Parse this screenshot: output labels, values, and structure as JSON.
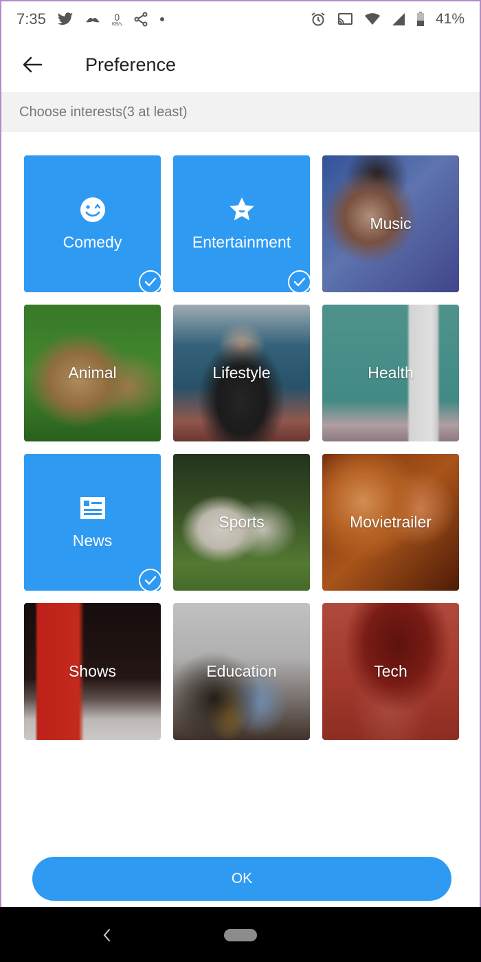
{
  "status_bar": {
    "time": "7:35",
    "net_speed_value": "0",
    "net_speed_unit": "KB/s",
    "battery_percent": "41%",
    "left_icons": [
      "twitter-icon",
      "mustache-icon",
      "share-icon",
      "dot-icon"
    ],
    "right_icons": [
      "alarm-icon",
      "cast-icon",
      "wifi-icon",
      "signal-icon",
      "battery-icon"
    ]
  },
  "app_bar": {
    "back_icon": "arrow-left-icon",
    "title": "Preference"
  },
  "subheader": {
    "text": "Choose interests(3 at least)"
  },
  "accent_color": "#2e9af2",
  "interests": [
    {
      "label": "Comedy",
      "selected": true,
      "icon": "wink-face-icon"
    },
    {
      "label": "Entertainment",
      "selected": true,
      "icon": "star-icon"
    },
    {
      "label": "Music",
      "selected": false
    },
    {
      "label": "Animal",
      "selected": false
    },
    {
      "label": "Lifestyle",
      "selected": false
    },
    {
      "label": "Health",
      "selected": false
    },
    {
      "label": "News",
      "selected": true,
      "icon": "newspaper-icon"
    },
    {
      "label": "Sports",
      "selected": false
    },
    {
      "label": "Movietrailer",
      "selected": false
    },
    {
      "label": "Shows",
      "selected": false
    },
    {
      "label": "Education",
      "selected": false
    },
    {
      "label": "Tech",
      "selected": false
    }
  ],
  "ok_button": {
    "label": "OK"
  }
}
